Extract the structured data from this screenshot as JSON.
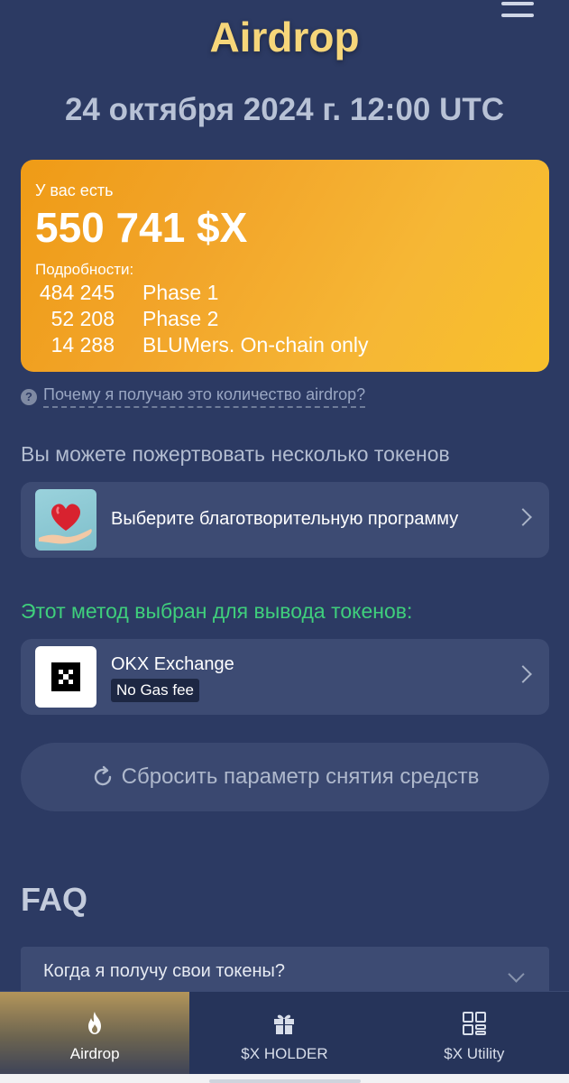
{
  "header": {
    "title": "Airdrop",
    "menu_icon": "hamburger-menu-icon"
  },
  "airdrop_date": "24 октября 2024 г. 12:00 UTC",
  "balance": {
    "label": "У вас есть",
    "amount": "550 741 $X",
    "details_label": "Подробности:",
    "rows": [
      {
        "value": "484 245",
        "name": "Phase 1"
      },
      {
        "value": "52 208",
        "name": "Phase 2"
      },
      {
        "value": "14 288",
        "name": "BLUMers. On-chain only"
      }
    ],
    "colors": {
      "start": "#ef9b16",
      "end": "#f8c12b"
    }
  },
  "why_link": "Почему я получаю это количество airdrop?",
  "donate": {
    "heading": "Вы можете пожертвовать несколько токенов",
    "card_label": "Выберите благотворительную программу"
  },
  "method": {
    "heading": "Этот метод выбран для вывода токенов:",
    "name": "OKX Exchange",
    "badge": "No Gas fee",
    "heading_color": "#3fcf7c"
  },
  "reset_button": "Сбросить параметр снятия средств",
  "faq": {
    "title": "FAQ",
    "items": [
      {
        "question": "Когда я получу свои токены?"
      }
    ]
  },
  "nav": {
    "items": [
      {
        "label": "Airdrop",
        "icon": "flame-icon",
        "active": true
      },
      {
        "label": "$X HOLDER",
        "icon": "gift-icon",
        "active": false
      },
      {
        "label": "$X Utility",
        "icon": "grid-icon",
        "active": false
      }
    ]
  }
}
